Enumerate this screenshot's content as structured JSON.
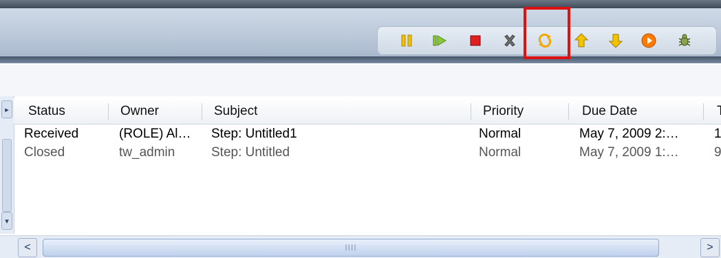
{
  "toolbar": {
    "buttons": [
      {
        "name": "pause-icon",
        "color": "#e8b400"
      },
      {
        "name": "resume-icon",
        "color": "#7fbf1f"
      },
      {
        "name": "stop-icon",
        "color": "#e02020"
      },
      {
        "name": "delete-icon",
        "color": "#6b6b6b"
      },
      {
        "name": "refresh-icon",
        "color": "#f0a800",
        "highlighted": true
      },
      {
        "name": "arrow-up-icon",
        "color": "#f2b400"
      },
      {
        "name": "arrow-down-icon",
        "color": "#f2b400"
      },
      {
        "name": "run-icon",
        "color": "#ff7a00"
      },
      {
        "name": "debug-icon",
        "color": "#5f7f2f"
      }
    ],
    "highlight_color": "#e01010"
  },
  "table": {
    "columns": [
      "Status",
      "Owner",
      "Subject",
      "Priority",
      "Due Date",
      "T"
    ],
    "rows": [
      {
        "status": "Received",
        "owner": "(ROLE) Al…",
        "subject": "Step: Untitled1",
        "priority": "Normal",
        "due_date": "May 7, 2009 2:…",
        "extra": "1"
      },
      {
        "status": "Closed",
        "owner": "tw_admin",
        "subject": "Step: Untitled",
        "priority": "Normal",
        "due_date": "May 7, 2009 1:…",
        "extra": "9"
      }
    ]
  },
  "scrollbar": {
    "left_arrow": "<",
    "right_arrow": ">",
    "grip": "IIII"
  }
}
